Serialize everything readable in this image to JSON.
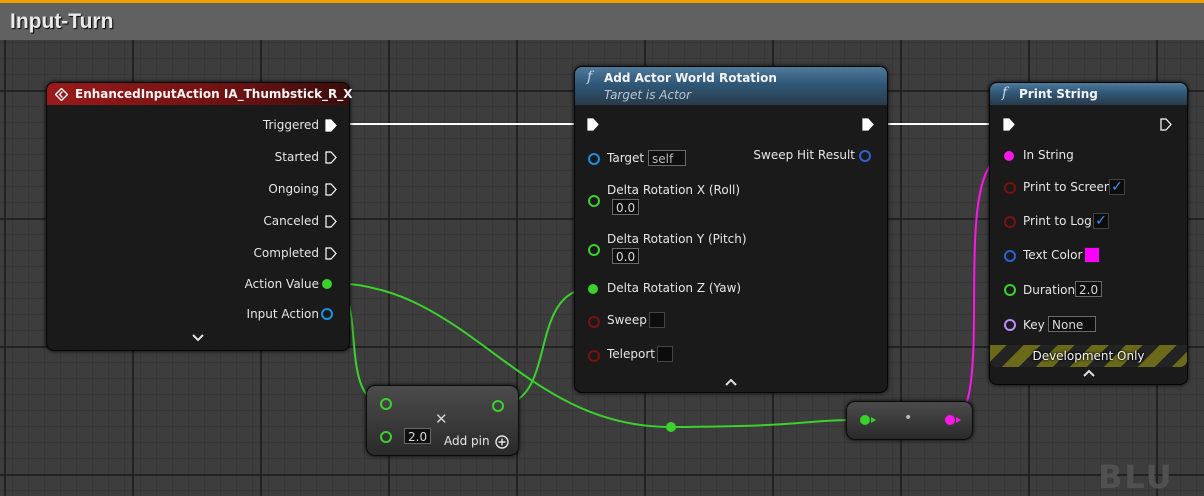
{
  "graph_title": "Input-Turn",
  "watermark": "BLU",
  "colors": {
    "exec": "#ffffff",
    "float": "#3bd12c",
    "object": "#1e8ee0",
    "string": "#ff17e8",
    "bool": "#7a1010",
    "struct": "#3060d0",
    "key": "#c08cff"
  },
  "input_node": {
    "title": "EnhancedInputAction IA_Thumbstick_R_X",
    "icon": "input-event-icon",
    "outputs": [
      "Triggered",
      "Started",
      "Ongoing",
      "Canceled",
      "Completed",
      "Action Value",
      "Input Action"
    ],
    "expand_icon": "chevron-down-icon"
  },
  "rotation_node": {
    "title": "Add Actor World Rotation",
    "subtitle": "Target is Actor",
    "fn_icon": "f",
    "target_label": "Target",
    "target_value": "self",
    "sweep_hit_result_label": "Sweep Hit Result",
    "delta_x_label": "Delta Rotation X (Roll)",
    "delta_x_value": "0.0",
    "delta_y_label": "Delta Rotation Y (Pitch)",
    "delta_y_value": "0.0",
    "delta_z_label": "Delta Rotation Z (Yaw)",
    "sweep_label": "Sweep",
    "teleport_label": "Teleport",
    "collapse_icon": "chevron-up-icon"
  },
  "print_node": {
    "title": "Print String",
    "fn_icon": "f",
    "in_string_label": "In String",
    "print_to_screen_label": "Print to Screen",
    "print_to_screen_checked": true,
    "print_to_log_label": "Print to Log",
    "print_to_log_checked": true,
    "text_color_label": "Text Color",
    "text_color_value": "#ff00ff",
    "duration_label": "Duration",
    "duration_value": "2.0",
    "key_label": "Key",
    "key_value": "None",
    "dev_only_label": "Development Only",
    "collapse_icon": "chevron-up-icon"
  },
  "multiply_node": {
    "operator_symbol": "✕",
    "b_value": "2.0",
    "add_pin_label": "Add pin",
    "add_pin_icon": "plus-circle-icon"
  },
  "conversion_node": {
    "dot_symbol": "•"
  }
}
